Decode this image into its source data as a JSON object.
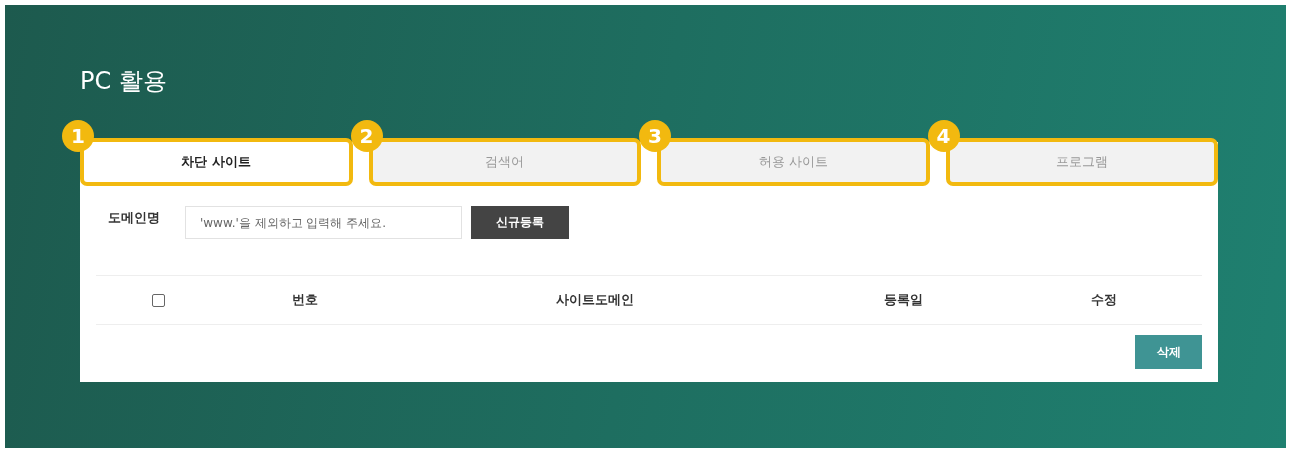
{
  "page_title": "PC 활용",
  "tabs": [
    {
      "badge": "1",
      "label": "차단 사이트",
      "selected": true
    },
    {
      "badge": "2",
      "label": "검색어",
      "selected": false
    },
    {
      "badge": "3",
      "label": "허용 사이트",
      "selected": false
    },
    {
      "badge": "4",
      "label": "프로그램",
      "selected": false
    }
  ],
  "form": {
    "label": "도메인명",
    "placeholder": "'www.'을 제외하고 입력해 주세요.",
    "button": "신규등록"
  },
  "table": {
    "columns": [
      {
        "kind": "checkbox",
        "checked": false
      },
      {
        "kind": "text",
        "label": "번호"
      },
      {
        "kind": "text",
        "label": "사이트도메인"
      },
      {
        "kind": "text",
        "label": "등록일"
      },
      {
        "kind": "text",
        "label": "수정"
      }
    ]
  },
  "delete_button": "삭제"
}
